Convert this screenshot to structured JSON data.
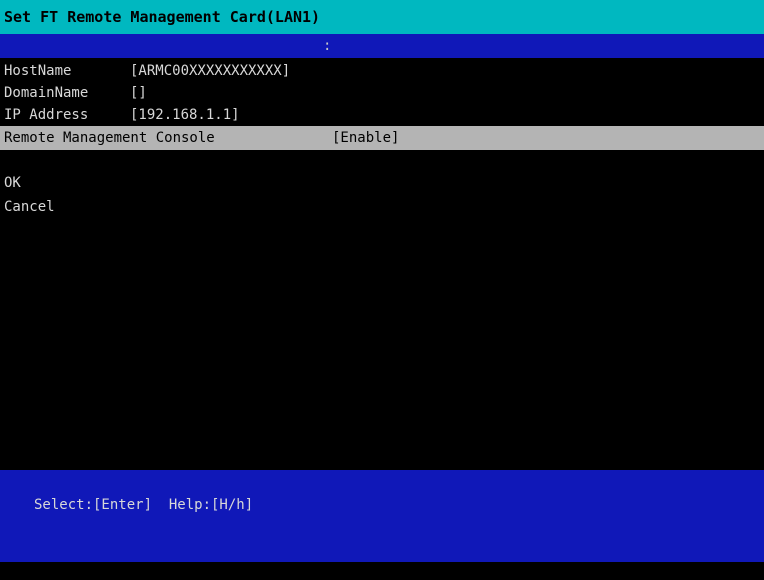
{
  "header": {
    "title": "Set FT Remote Management Card(LAN1)",
    "indicator": ":"
  },
  "fields": {
    "hostname": {
      "label": "HostName",
      "value": "[ARMC00XXXXXXXXXXX]"
    },
    "domain": {
      "label": "DomainName",
      "value": "[]"
    },
    "ip": {
      "label": "IP Address",
      "value": "[192.168.1.1]"
    }
  },
  "selected": {
    "label": "Remote Management Console",
    "value": "[Enable]"
  },
  "actions": {
    "ok": "OK",
    "cancel": "Cancel"
  },
  "footer": {
    "help": "Select:[Enter]  Help:[H/h]"
  },
  "colors": {
    "title_bar": "#00b8c0",
    "panel_blue": "#1018b8",
    "selection": "#b4b4b4",
    "background": "#000000",
    "text": "#d8d8d8"
  }
}
